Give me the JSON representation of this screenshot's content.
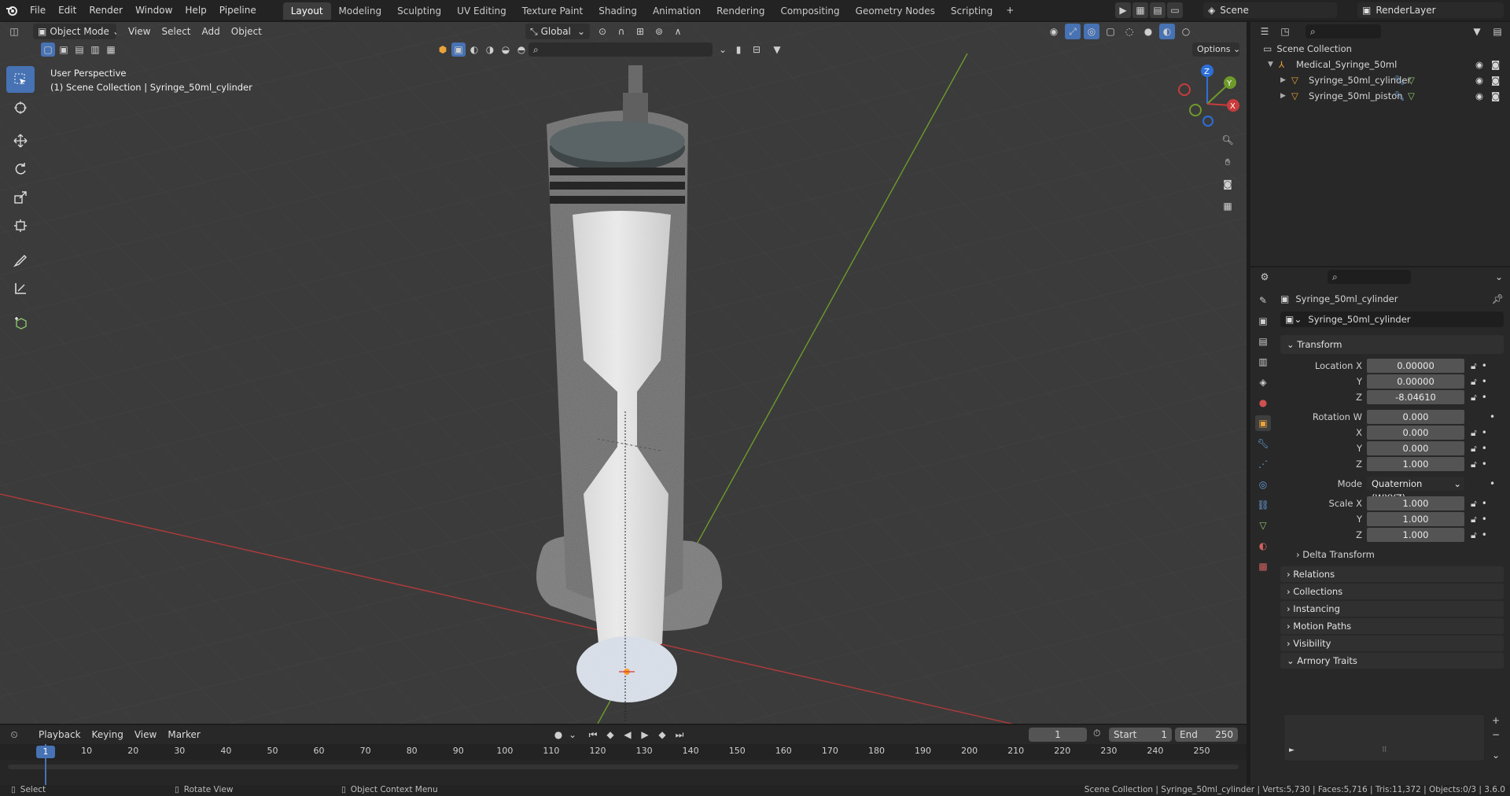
{
  "menubar": {
    "items": [
      "File",
      "Edit",
      "Render",
      "Window",
      "Help",
      "Pipeline"
    ],
    "workspaces": [
      "Layout",
      "Modeling",
      "Sculpting",
      "UV Editing",
      "Texture Paint",
      "Shading",
      "Animation",
      "Rendering",
      "Compositing",
      "Geometry Nodes",
      "Scripting"
    ],
    "active_workspace": "Layout",
    "scene": "Scene",
    "view_layer": "RenderLayer"
  },
  "viewport_header": {
    "mode": "Object Mode",
    "menus": [
      "View",
      "Select",
      "Add",
      "Object"
    ],
    "orientation": "Global",
    "options": "Options"
  },
  "viewport": {
    "perspective": "User Perspective",
    "context": "(1) Scene Collection | Syringe_50ml_cylinder",
    "gizmo_axes": [
      "X",
      "Y",
      "Z"
    ]
  },
  "outliner": {
    "root": "Scene Collection",
    "items": [
      {
        "name": "Medical_Syringe_50ml",
        "depth": 1
      },
      {
        "name": "Syringe_50ml_cylinder",
        "depth": 2
      },
      {
        "name": "Syringe_50ml_piston",
        "depth": 2
      }
    ]
  },
  "properties": {
    "object_name": "Syringe_50ml_cylinder",
    "datablock_name": "Syringe_50ml_cylinder",
    "transform_title": "Transform",
    "location": {
      "label": "Location X",
      "x": "0.00000",
      "y": "0.00000",
      "z": "-8.04610"
    },
    "rotation": {
      "label": "Rotation W",
      "w": "0.000",
      "x": "0.000",
      "y": "0.000",
      "z": "1.000"
    },
    "mode_label": "Mode",
    "mode_value": "Quaternion (WXYZ)",
    "scale": {
      "label": "Scale X",
      "x": "1.000",
      "y": "1.000",
      "z": "1.000"
    },
    "axis_labels": {
      "y": "Y",
      "z": "Z",
      "x": "X"
    },
    "delta_transform": "Delta Transform",
    "panels": [
      "Relations",
      "Collections",
      "Instancing",
      "Motion Paths",
      "Visibility",
      "Armory Traits"
    ]
  },
  "timeline": {
    "menus": [
      "Playback",
      "Keying",
      "View",
      "Marker"
    ],
    "current_frame": "1",
    "start_label": "Start",
    "start": "1",
    "end_label": "End",
    "end": "250",
    "ticks": [
      "1",
      "10",
      "20",
      "30",
      "40",
      "50",
      "60",
      "70",
      "80",
      "90",
      "100",
      "110",
      "120",
      "130",
      "140",
      "150",
      "160",
      "170",
      "180",
      "190",
      "200",
      "210",
      "220",
      "230",
      "240",
      "250"
    ]
  },
  "statusbar": {
    "select": "Select",
    "rotate": "Rotate View",
    "context_menu": "Object Context Menu",
    "stats": "Scene Collection | Syringe_50ml_cylinder | Verts:5,730 | Faces:5,716 | Tris:11,372 | Objects:0/3 | 3.6.0"
  },
  "colors": {
    "accent": "#4772b3",
    "x_axis": "#c83c3c",
    "y_axis": "#6e9a2a",
    "origin": "#ff9a2a"
  }
}
